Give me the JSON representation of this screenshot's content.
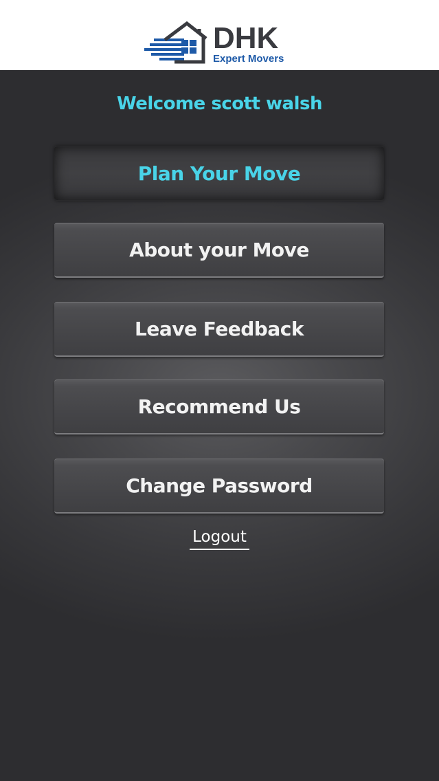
{
  "brand": {
    "name": "DHK",
    "tagline": "Expert Movers",
    "colors": {
      "blue": "#1e5aa8",
      "dark": "#3a3b40"
    }
  },
  "welcome_text": "Welcome scott walsh",
  "menu": [
    {
      "label": "Plan Your Move",
      "active": true
    },
    {
      "label": "About your Move",
      "active": false
    },
    {
      "label": "Leave Feedback",
      "active": false
    },
    {
      "label": "Recommend Us",
      "active": false
    },
    {
      "label": "Change Password",
      "active": false
    }
  ],
  "logout_label": "Logout",
  "colors": {
    "accent": "#49d4e8",
    "background": "#2b2b2d",
    "button_text": "#f2f2f2"
  }
}
